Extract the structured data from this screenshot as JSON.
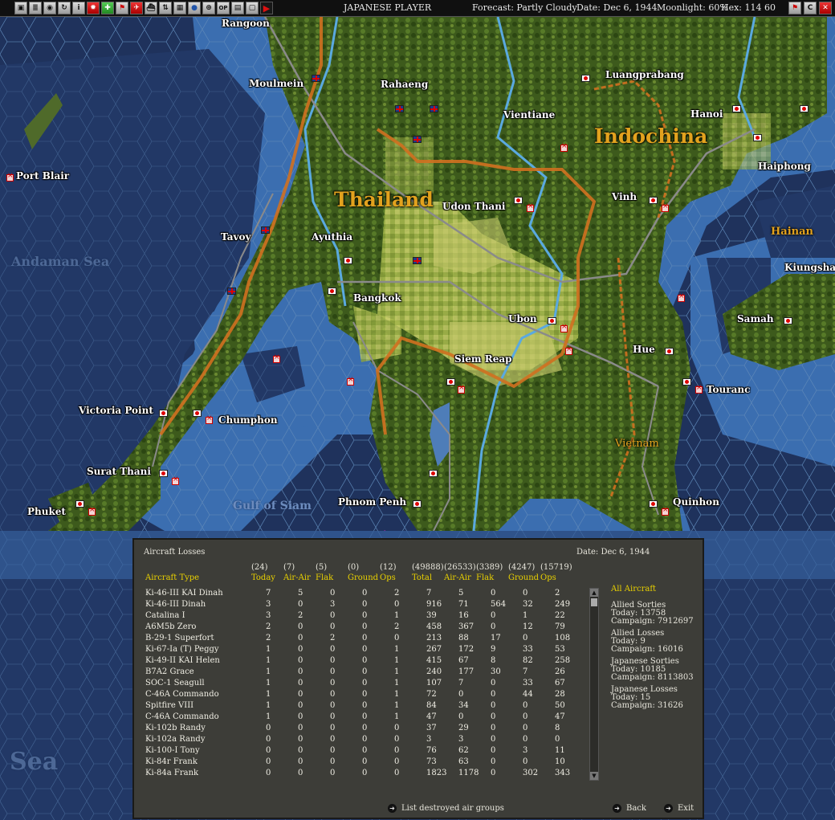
{
  "toolbar": {
    "icons": [
      "save-icon",
      "list-icon",
      "report-icon",
      "refresh-icon",
      "info-icon",
      "jp-flag-icon",
      "army-icon",
      "fleet-icon",
      "aircraft-icon",
      "ship-icon",
      "sort-icon",
      "unit-icon",
      "globe-icon",
      "zoom-icon",
      "op-icon",
      "screen-icon",
      "minimap-icon",
      "end-turn-icon"
    ],
    "player": "JAPANESE PLAYER",
    "forecast": "Forecast: Partly Cloudy",
    "date": "Date: Dec 6, 1944",
    "moonlight": "Moonlight: 60%",
    "hex": "Hex: 114 60"
  },
  "map": {
    "regions": [
      "Thailand",
      "Indochina",
      "Hainan",
      "Vietnam"
    ],
    "seas": [
      "Andaman Sea",
      "Gulf of Siam",
      "Sea"
    ],
    "cities": [
      "Rangoon",
      "Moulmein",
      "Rahaeng",
      "Luangprabang",
      "Vientiane",
      "Hanoi",
      "Haiphong",
      "Port Blair",
      "Udon Thani",
      "Vinh",
      "Tavoy",
      "Ayuthia",
      "Kiungsha",
      "Bangkok",
      "Ubon",
      "Samah",
      "Hue",
      "Siem Reap",
      "Touranc",
      "Victoria Point",
      "Chumphon",
      "Surat Thani",
      "Phuket",
      "Phnom Penh",
      "Quinhon"
    ]
  },
  "losses": {
    "title": "Aircraft Losses",
    "date": "Date: Dec 6, 1944",
    "col_label": "Aircraft Type",
    "totals": [
      "(24)",
      "(7)",
      "(5)",
      "(0)",
      "(12)",
      "(49888)",
      "(26533)",
      "(3389)",
      "(4247)",
      "(15719)"
    ],
    "headers": [
      "Today",
      "Air-Air",
      "Flak",
      "Ground",
      "Ops",
      "Total",
      "Air-Air",
      "Flak",
      "Ground",
      "Ops"
    ],
    "rows": [
      {
        "name": "Ki-46-III KAI Dinah",
        "v": [
          "7",
          "5",
          "0",
          "0",
          "2",
          "7",
          "5",
          "0",
          "0",
          "2"
        ]
      },
      {
        "name": "Ki-46-III Dinah",
        "v": [
          "3",
          "0",
          "3",
          "0",
          "0",
          "916",
          "71",
          "564",
          "32",
          "249"
        ]
      },
      {
        "name": "Catalina I",
        "v": [
          "3",
          "2",
          "0",
          "0",
          "1",
          "39",
          "16",
          "0",
          "1",
          "22"
        ]
      },
      {
        "name": "A6M5b Zero",
        "v": [
          "2",
          "0",
          "0",
          "0",
          "2",
          "458",
          "367",
          "0",
          "12",
          "79"
        ]
      },
      {
        "name": "B-29-1 Superfort",
        "v": [
          "2",
          "0",
          "2",
          "0",
          "0",
          "213",
          "88",
          "17",
          "0",
          "108"
        ]
      },
      {
        "name": "Ki-67-Ia (T) Peggy",
        "v": [
          "1",
          "0",
          "0",
          "0",
          "1",
          "267",
          "172",
          "9",
          "33",
          "53"
        ]
      },
      {
        "name": "Ki-49-II KAI Helen",
        "v": [
          "1",
          "0",
          "0",
          "0",
          "1",
          "415",
          "67",
          "8",
          "82",
          "258"
        ]
      },
      {
        "name": "B7A2 Grace",
        "v": [
          "1",
          "0",
          "0",
          "0",
          "1",
          "240",
          "177",
          "30",
          "7",
          "26"
        ]
      },
      {
        "name": "SOC-1 Seagull",
        "v": [
          "1",
          "0",
          "0",
          "0",
          "1",
          "107",
          "7",
          "0",
          "33",
          "67"
        ]
      },
      {
        "name": "C-46A Commando",
        "v": [
          "1",
          "0",
          "0",
          "0",
          "1",
          "72",
          "0",
          "0",
          "44",
          "28"
        ]
      },
      {
        "name": "Spitfire VIII",
        "v": [
          "1",
          "0",
          "0",
          "0",
          "1",
          "84",
          "34",
          "0",
          "0",
          "50"
        ]
      },
      {
        "name": "C-46A Commando",
        "v": [
          "1",
          "0",
          "0",
          "0",
          "1",
          "47",
          "0",
          "0",
          "0",
          "47"
        ]
      },
      {
        "name": "Ki-102b Randy",
        "v": [
          "0",
          "0",
          "0",
          "0",
          "0",
          "37",
          "29",
          "0",
          "0",
          "8"
        ]
      },
      {
        "name": "Ki-102a Randy",
        "v": [
          "0",
          "0",
          "0",
          "0",
          "0",
          "3",
          "3",
          "0",
          "0",
          "0"
        ]
      },
      {
        "name": "Ki-100-I Tony",
        "v": [
          "0",
          "0",
          "0",
          "0",
          "0",
          "76",
          "62",
          "0",
          "3",
          "11"
        ]
      },
      {
        "name": "Ki-84r Frank",
        "v": [
          "0",
          "0",
          "0",
          "0",
          "0",
          "73",
          "63",
          "0",
          "0",
          "10"
        ]
      },
      {
        "name": "Ki-84a Frank",
        "v": [
          "0",
          "0",
          "0",
          "0",
          "0",
          "1823",
          "1178",
          "0",
          "302",
          "343"
        ]
      }
    ],
    "stats": {
      "filter": "All Aircraft",
      "allied_sorties": {
        "title": "Allied Sorties",
        "today": "Today:  13758",
        "campaign": "Campaign: 7912697"
      },
      "allied_losses": {
        "title": "Allied Losses",
        "today": "Today:  9",
        "campaign": "Campaign: 16016"
      },
      "japanese_sorties": {
        "title": "Japanese Sorties",
        "today": "Today:  10185",
        "campaign": "Campaign: 8113803"
      },
      "japanese_losses": {
        "title": "Japanese Losses",
        "today": "Today:  15",
        "campaign": "Campaign: 31626"
      }
    },
    "buttons": {
      "list": "List destroyed air groups",
      "back": "Back",
      "exit": "Exit"
    }
  }
}
